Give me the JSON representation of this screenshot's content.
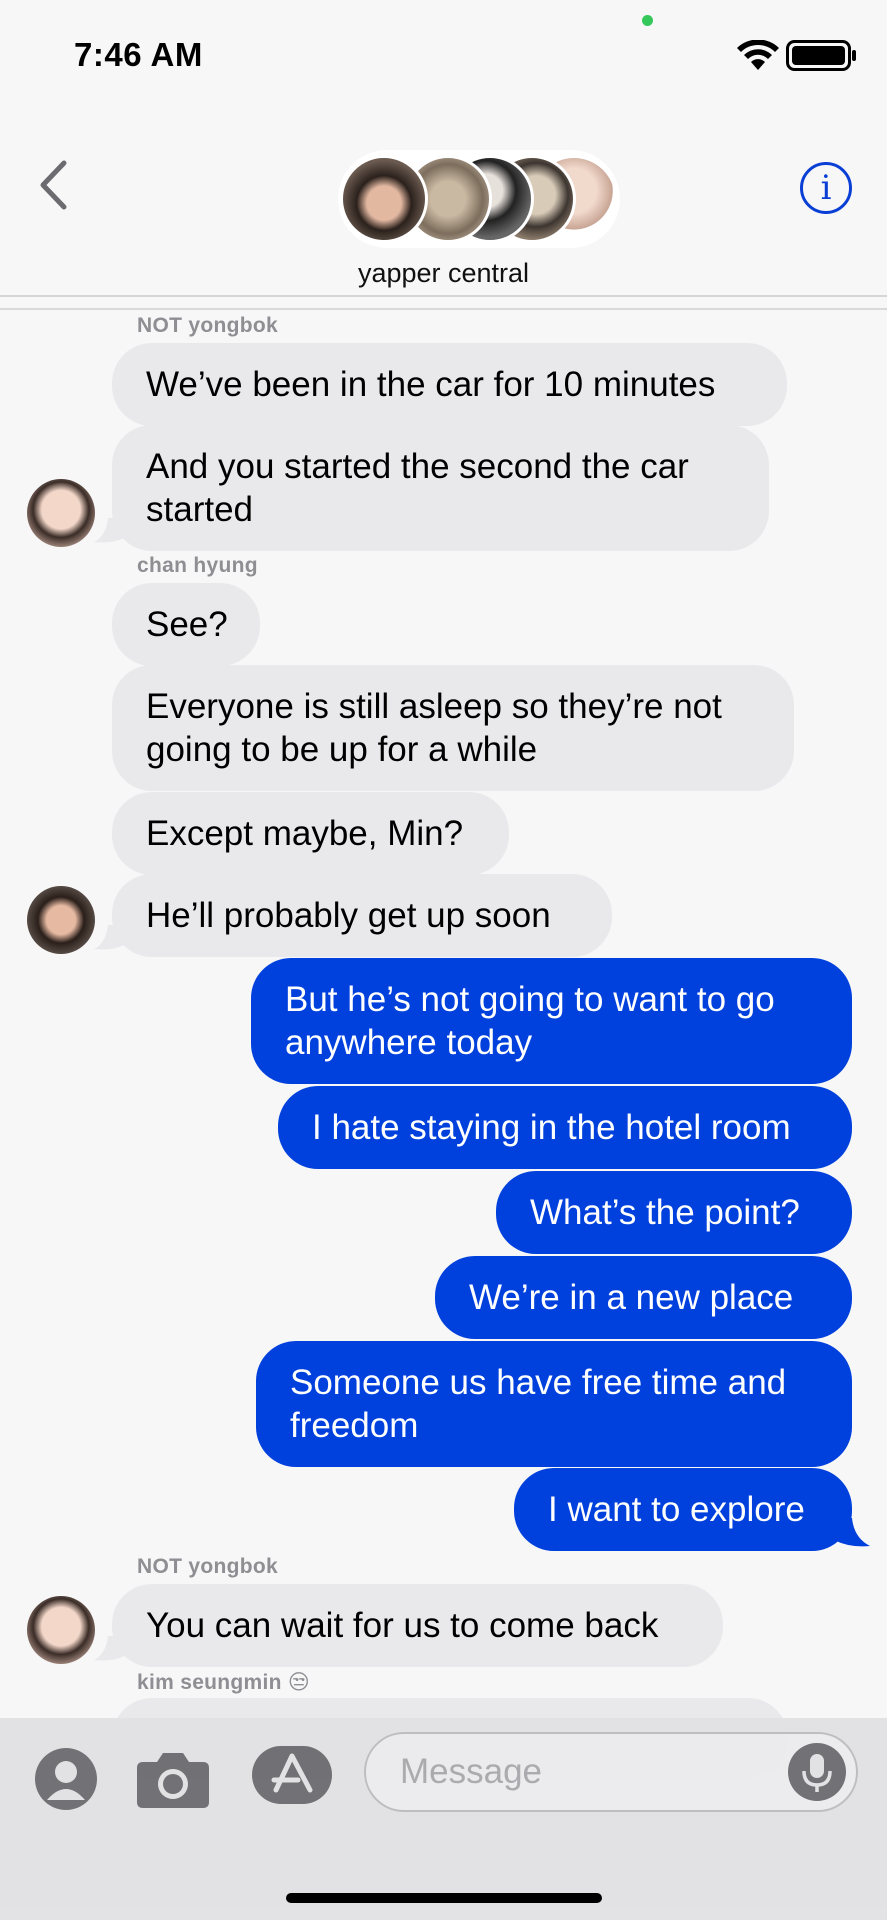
{
  "status_bar": {
    "time": "7:46 AM"
  },
  "header": {
    "title": "yapper central",
    "info_glyph": "i"
  },
  "messages": [
    {
      "sender": "NOT yongbok"
    },
    {
      "text": "We’ve been in the car for 10 minutes"
    },
    {
      "text": "And you started the second the car started"
    },
    {
      "sender": "chan hyung"
    },
    {
      "text": "See?"
    },
    {
      "text": "Everyone is still asleep so they’re not going to be up for a while"
    },
    {
      "text": "Except maybe, Min?"
    },
    {
      "text": "He’ll probably get up soon"
    },
    {
      "text": "But he’s not going to want to go anywhere today"
    },
    {
      "text": "I hate staying in the hotel room"
    },
    {
      "text": "What’s the point?"
    },
    {
      "text": "We’re in a new place"
    },
    {
      "text": "Someone us have free time and freedom"
    },
    {
      "text": "I want to explore"
    },
    {
      "sender": "NOT yongbok"
    },
    {
      "text": "You can wait for us to come back"
    },
    {
      "sender": "kim seungmin 😒"
    }
  ],
  "input": {
    "placeholder": "Message"
  },
  "icons": [
    "back-chevron-icon",
    "info-icon",
    "contact-icon",
    "camera-icon",
    "app-store-icon",
    "microphone-icon",
    "wifi-icon",
    "battery-icon"
  ],
  "colors": {
    "outgoing_bubble": "#0040dd",
    "incoming_bubble": "#e9e9eb",
    "accent": "#0a3fd6"
  }
}
